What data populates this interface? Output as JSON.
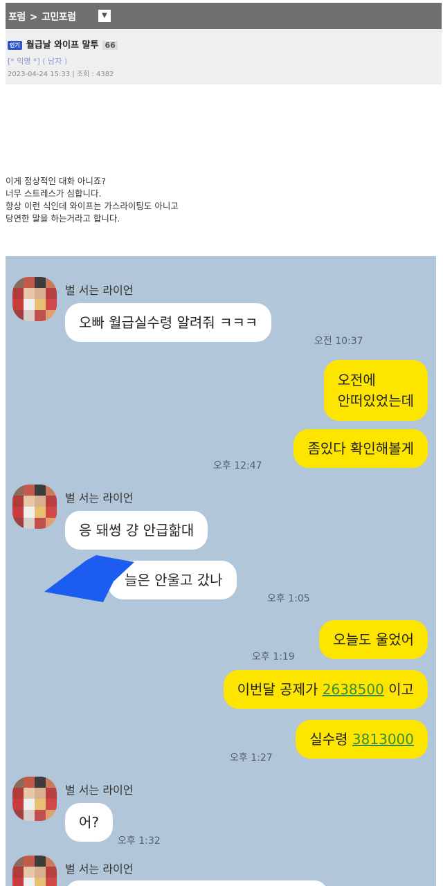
{
  "header": {
    "breadcrumb": [
      "포럼",
      "고민포럼"
    ],
    "separator": ">"
  },
  "post": {
    "badge": "인기",
    "title": "월급날 와이프 말투",
    "comment_count": "66",
    "author": "[* 익명 *] ( 남자 )",
    "dateline": "2023-04-24 15:33 | 조회 : 4382",
    "body": [
      "이게 정상적인 대화 아니죠?",
      "너무 스트레스가 심합니다.",
      "항상 이런 식인데 와이프는 가스라이팅도 아니고",
      "당연한 말을 하는거라고 합니다."
    ]
  },
  "chat": {
    "background": "#b2c6d9",
    "sender_name": "벌 서는 라이언",
    "messages": [
      {
        "from": "other",
        "text": "오빠 월급실수령 알려줘 ㅋㅋㅋ",
        "time": "오전 10:37"
      },
      {
        "from": "me",
        "text": "오전에\n안떠있었는데"
      },
      {
        "from": "me",
        "text": "좀있다 확인해볼게",
        "time": "오후 12:47"
      },
      {
        "from": "other",
        "text": "응 돼썽 걍 안급핢대"
      },
      {
        "from": "other",
        "text": "늘은 안울고 갔나",
        "time": "오후 1:05"
      },
      {
        "from": "me",
        "text": "오늘도 울었어",
        "time": "오후 1:19"
      },
      {
        "from": "me",
        "text_prefix": "이번달 공제가 ",
        "number": "2638500",
        "text_suffix": " 이고"
      },
      {
        "from": "me",
        "text_prefix": "실수령 ",
        "number": "3813000",
        "time": "오후 1:27"
      },
      {
        "from": "other",
        "text": "어?",
        "time": "오후 1:32"
      }
    ]
  },
  "colors": {
    "my_bubble": "#fee500",
    "other_bubble": "#ffffff",
    "topbar": "#6f6f6f",
    "badge": "#2a55c8"
  }
}
